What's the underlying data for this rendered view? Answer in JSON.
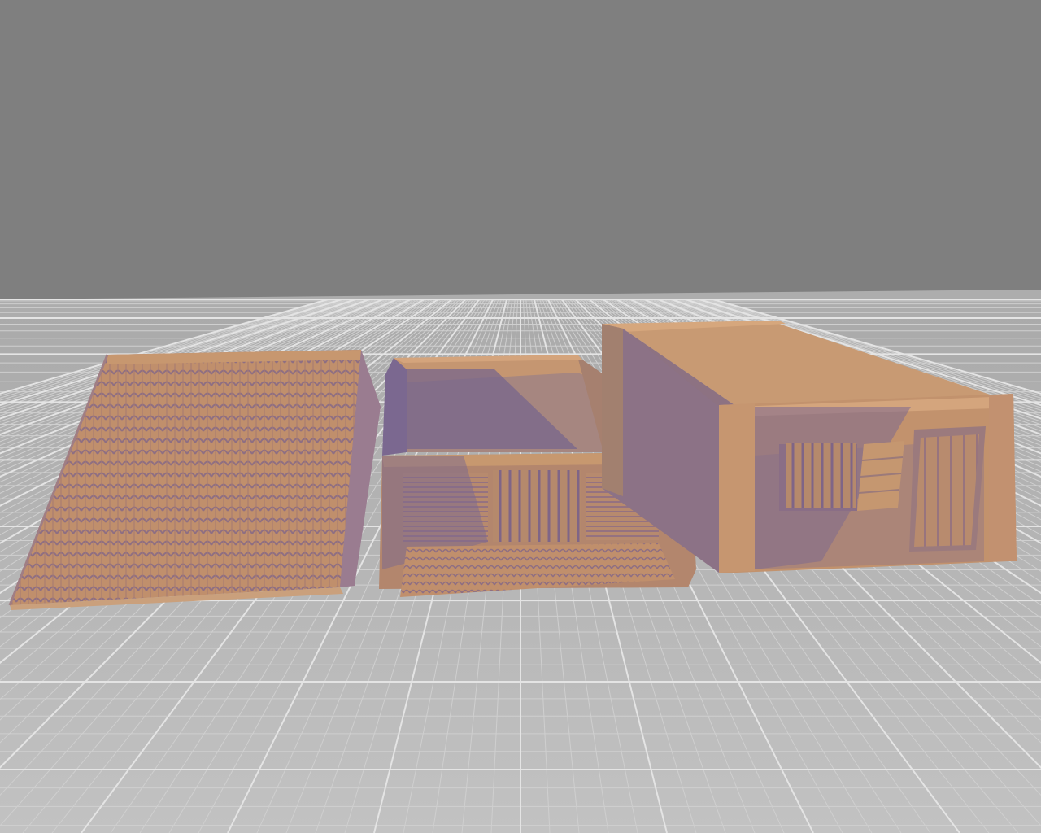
{
  "scene": {
    "background_color": "#7f7f7f",
    "floor_color": "#b8b8b8",
    "grid_line_color": "#d2d2d2",
    "grid_major_color": "#e6e6e6",
    "model_colors": {
      "light": "#c99a73",
      "mid": "#b48567",
      "shade": "#8e6f86",
      "dark": "#6f5f8a",
      "edge": "#a88ab0"
    },
    "objects": [
      {
        "name": "roof-panel",
        "description_icon": "tiled-roof"
      },
      {
        "name": "open-box-with-shutters",
        "description_icon": "wall-box"
      },
      {
        "name": "house-with-window-and-door",
        "description_icon": "house"
      }
    ]
  }
}
